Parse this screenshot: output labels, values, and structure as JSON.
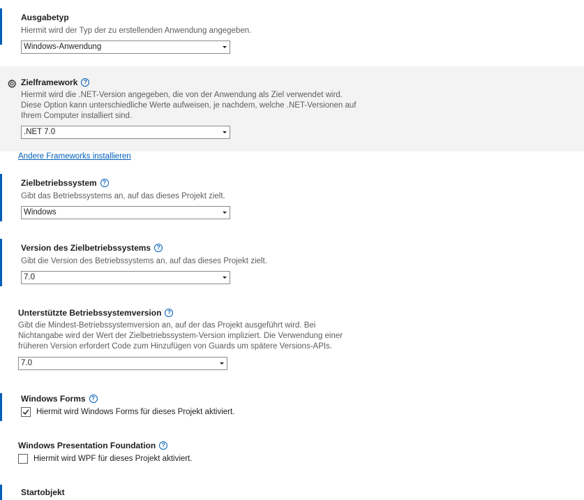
{
  "accent_color": "#005fb8",
  "output_type": {
    "title": "Ausgabetyp",
    "description": "Hiermit wird der Typ der zu erstellenden Anwendung angegeben.",
    "value": "Windows-Anwendung"
  },
  "target_framework": {
    "title": "Zielframework",
    "description_lines": [
      "Hiermit wird die .NET-Version angegeben, die von der Anwendung als Ziel verwendet wird.",
      "Diese Option kann unterschiedliche Werte aufweisen, je nachdem, welche .NET-Versionen auf",
      "Ihrem Computer installiert sind."
    ],
    "value": ".NET 7.0",
    "link": "Andere Frameworks installieren"
  },
  "target_os": {
    "title": "Zielbetriebssystem",
    "description": "Gibt das Betriebssystems an, auf das dieses Projekt zielt.",
    "value": "Windows"
  },
  "target_os_version": {
    "title": "Version des Zielbetriebssystems",
    "description": "Gibt die Version des Betriebssystems an, auf das dieses Projekt zielt.",
    "value": "7.0"
  },
  "supported_os_version": {
    "title": "Unterstützte Betriebssystemversion",
    "description_lines": [
      "Gibt die Mindest-Betriebssystemversion an, auf der das Projekt ausgeführt wird. Bei",
      "Nichtangabe wird der Wert der Zielbetriebssystem-Version impliziert. Die Verwendung einer",
      "früheren Version erfordert Code zum Hinzufügen von Guards um spätere Versions-APIs."
    ],
    "value": "7.0"
  },
  "windows_forms": {
    "title": "Windows Forms",
    "checkbox_label": "Hiermit wird Windows Forms für dieses Projekt aktiviert.",
    "checked": true
  },
  "wpf": {
    "title": "Windows Presentation Foundation",
    "checkbox_label": "Hiermit wird WPF für dieses Projekt aktiviert.",
    "checked": false
  },
  "startup_object": {
    "title": "Startobjekt"
  }
}
